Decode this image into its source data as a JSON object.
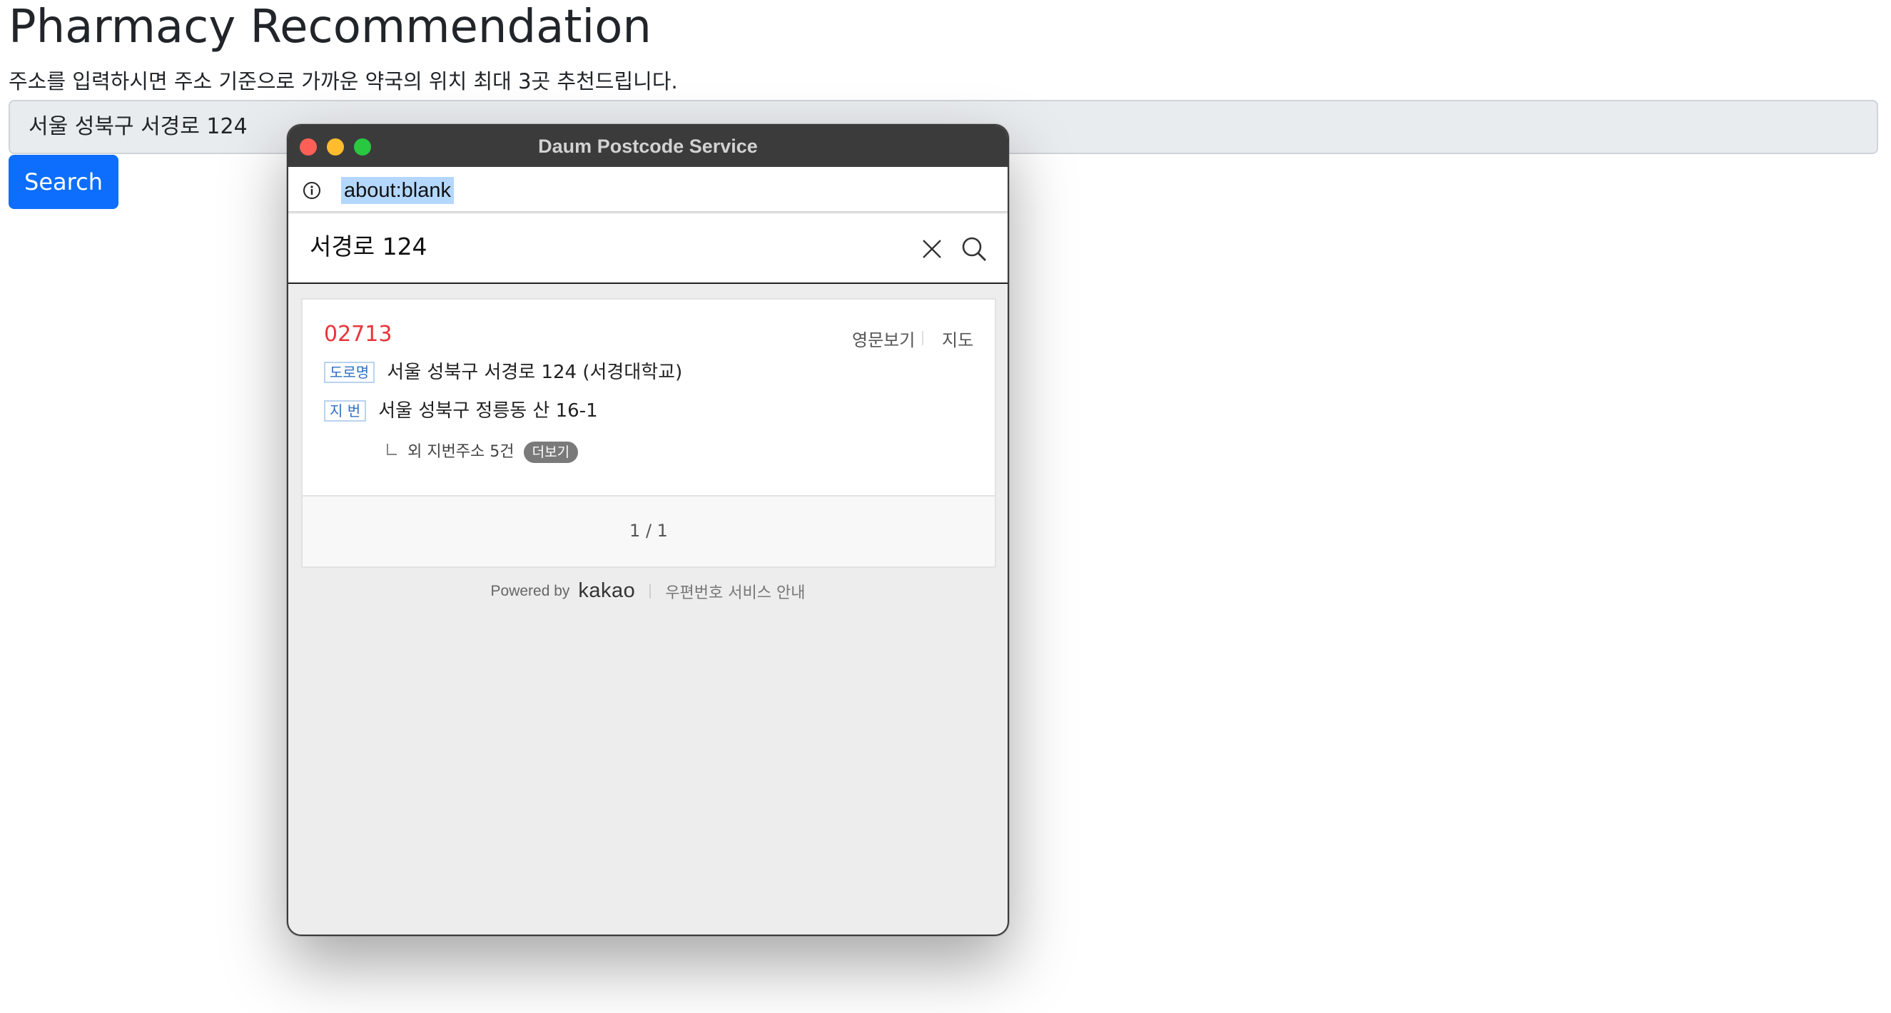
{
  "page": {
    "title": "Pharmacy Recommendation",
    "description": "주소를 입력하시면 주소 기준으로 가까운 약국의 위치 최대 3곳 추천드립니다.",
    "address_value": "서울 성북구 서경로 124",
    "search_label": "Search"
  },
  "popup": {
    "window_title": "Daum Postcode Service",
    "url": "about:blank",
    "search_query": "서경로 124",
    "result": {
      "zipcode": "02713",
      "english_link": "영문보기",
      "map_link": "지도",
      "road_badge": "도로명",
      "road_address": "서울 성북구 서경로 124 (서경대학교)",
      "jibun_badge": "지 번",
      "jibun_address": "서울 성북구 정릉동 산 16-1",
      "extra_text": "외 지번주소 5건",
      "more_label": "더보기"
    },
    "pagination": "1 / 1",
    "footer": {
      "powered_by": "Powered by",
      "brand": "kakao",
      "service_link": "우편번호 서비스 안내"
    }
  },
  "colors": {
    "primary_button": "#0d6efd",
    "zipcode": "#e8353b",
    "badge_text": "#2f6fc2",
    "titlebar": "#3b3b3b",
    "url_highlight": "#b3d7ff"
  },
  "icons": {
    "window_controls": [
      "close-dot",
      "minimize-dot",
      "zoom-dot"
    ],
    "url_info": "info-icon",
    "clear": "close-icon",
    "search": "search-icon"
  }
}
